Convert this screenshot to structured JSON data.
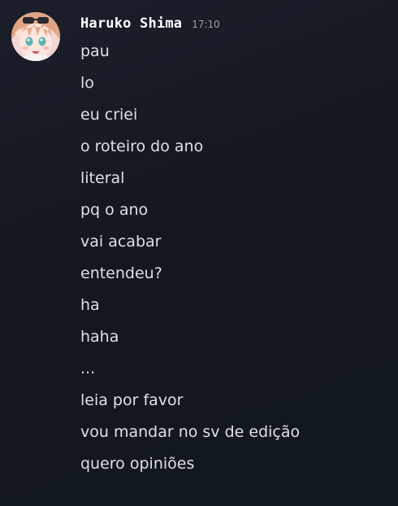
{
  "message": {
    "author": "Haruko Shima",
    "timestamp": "17:10",
    "avatar_icon": "anime-girl-avatar",
    "lines": [
      "pau",
      "lo",
      "eu criei",
      "o roteiro do ano",
      "literal",
      "pq o ano",
      "vai acabar",
      "entendeu?",
      "ha",
      "haha",
      "...",
      "leia por favor",
      "vou mandar no sv de edição",
      "quero opiniões"
    ]
  },
  "colors": {
    "background": "#1a1c26",
    "username": "#ffffff",
    "text": "#dfe0e6",
    "timestamp": "#9a9ca6"
  }
}
